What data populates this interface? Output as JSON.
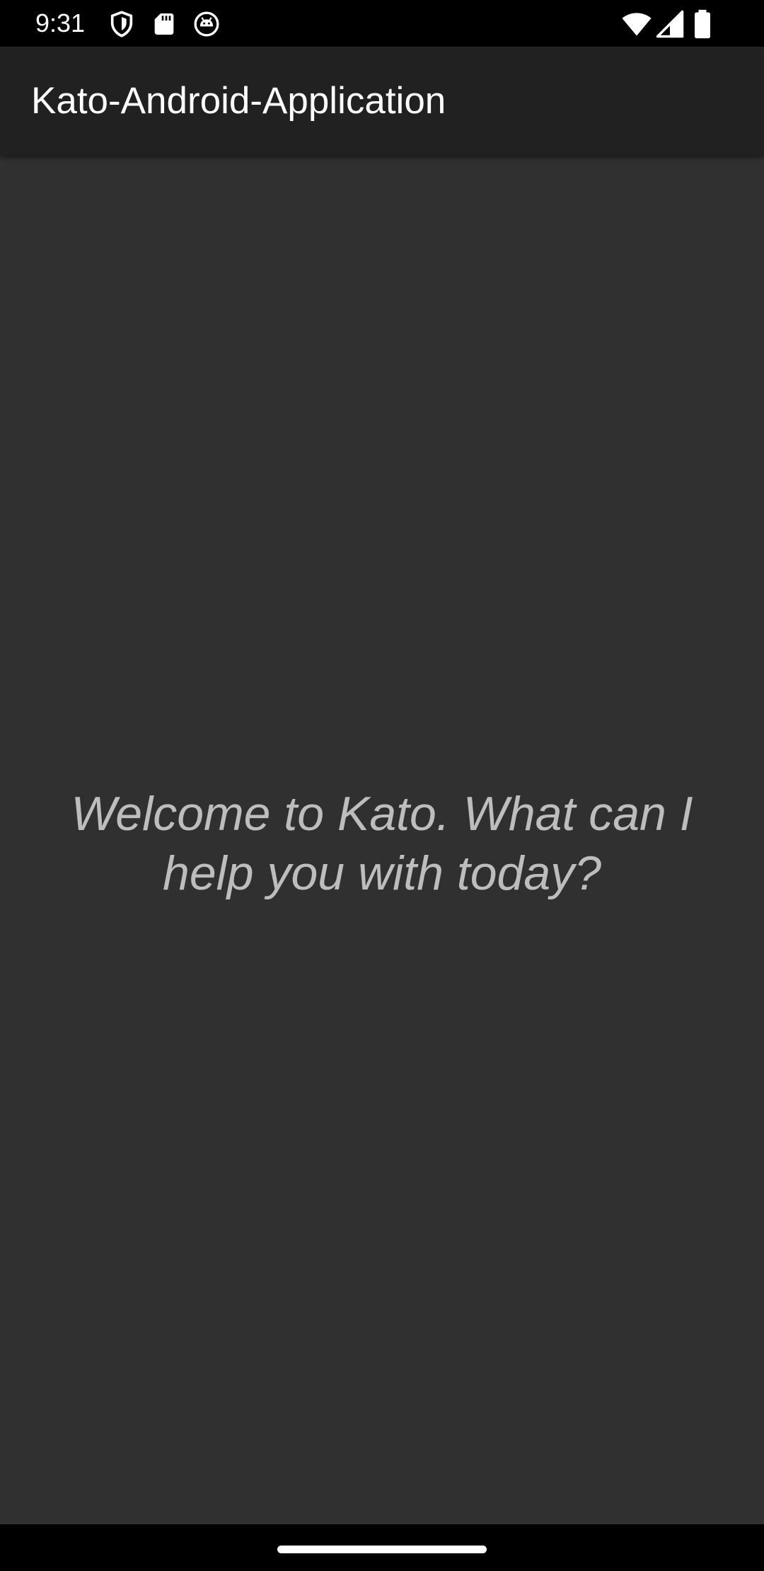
{
  "status_bar": {
    "time": "9:31",
    "left_icons": [
      "shield-icon",
      "sd-card-icon",
      "android-head-icon"
    ],
    "right_icons": [
      "wifi-icon",
      "cell-signal-icon",
      "battery-icon"
    ]
  },
  "app_bar": {
    "title": "Kato-Android-Application"
  },
  "main": {
    "welcome_message": "Welcome to Kato. What can I help you with today?"
  },
  "nav_bar": {
    "handle": "home-gesture-handle"
  },
  "colors": {
    "status_bar_bg": "#000000",
    "app_bar_bg": "#212121",
    "content_bg": "#303030",
    "welcome_text": "#bdbdbd",
    "title_text": "#ffffff"
  }
}
